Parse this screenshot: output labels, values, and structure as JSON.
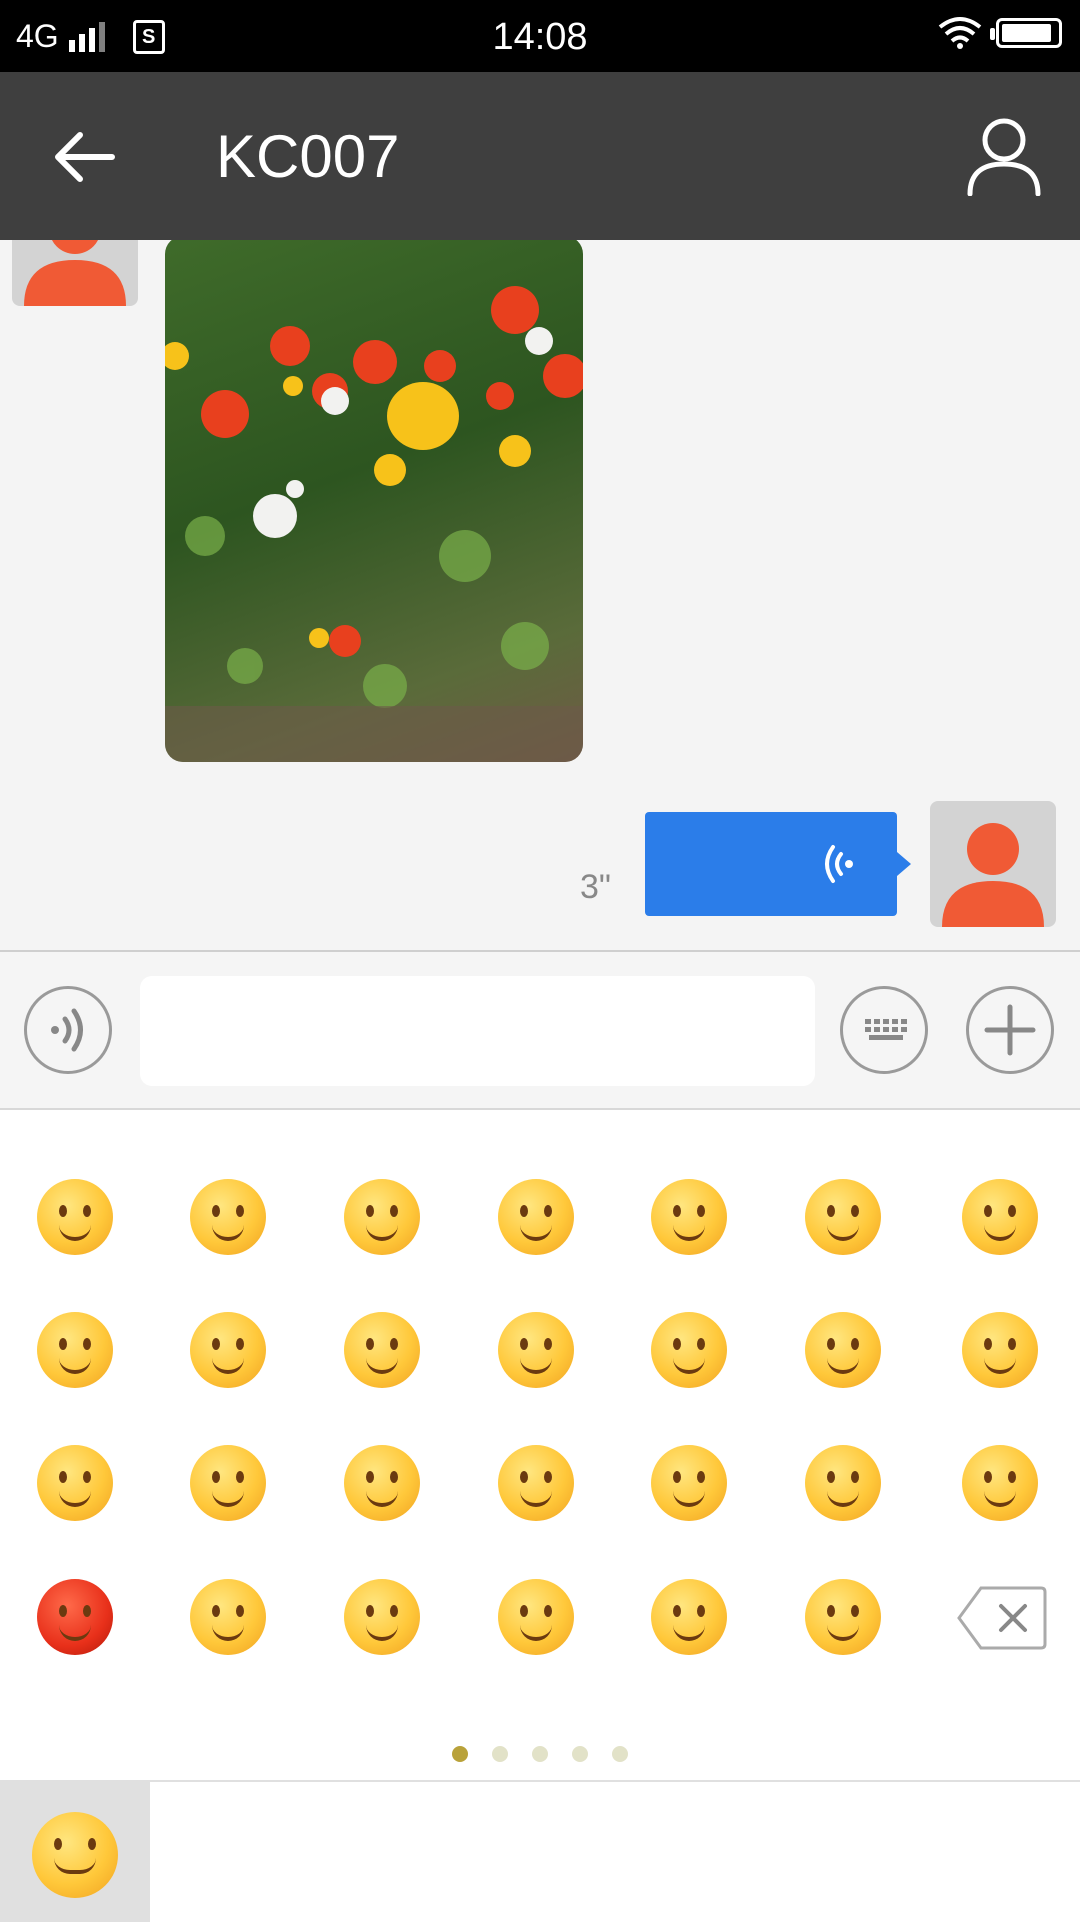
{
  "status_bar": {
    "network": "4G",
    "sim_badge": "S",
    "time": "14:08",
    "battery_level": 0.9,
    "icons": [
      "signal-icon",
      "sim-icon",
      "wifi-icon",
      "battery-icon"
    ]
  },
  "header": {
    "title": "KC007",
    "back_icon": "arrow-left-icon",
    "profile_icon": "person-icon"
  },
  "chat": {
    "messages": [
      {
        "type": "image",
        "side": "left",
        "description_icon": "photo"
      },
      {
        "type": "voice",
        "side": "right",
        "duration": "3\""
      }
    ]
  },
  "input_bar": {
    "voice_icon": "voice-icon",
    "text_value": "",
    "keyboard_icon": "keyboard-icon",
    "plus_icon": "plus-icon"
  },
  "emoji_panel": {
    "rows": [
      [
        "😊",
        "😃",
        "😍",
        "🤫",
        "😚",
        "😳",
        "😂"
      ],
      [
        "😓",
        "😁",
        "😜",
        "😌",
        "🤭",
        "😉",
        "🥺"
      ],
      [
        "🔨",
        "😲",
        "😢",
        "🤐",
        "😭",
        "😱",
        "😱"
      ],
      [
        "😡",
        "😎",
        "🤐",
        "😤",
        "😔",
        "😏",
        "⌫"
      ]
    ],
    "pages": 5,
    "current_page": 1
  },
  "bottom_bar": {
    "selected_tab": "😁"
  },
  "colors": {
    "header_bg": "#3f3f3f",
    "voice_bubble": "#2b7de9",
    "avatar_orange": "#f05a35"
  }
}
